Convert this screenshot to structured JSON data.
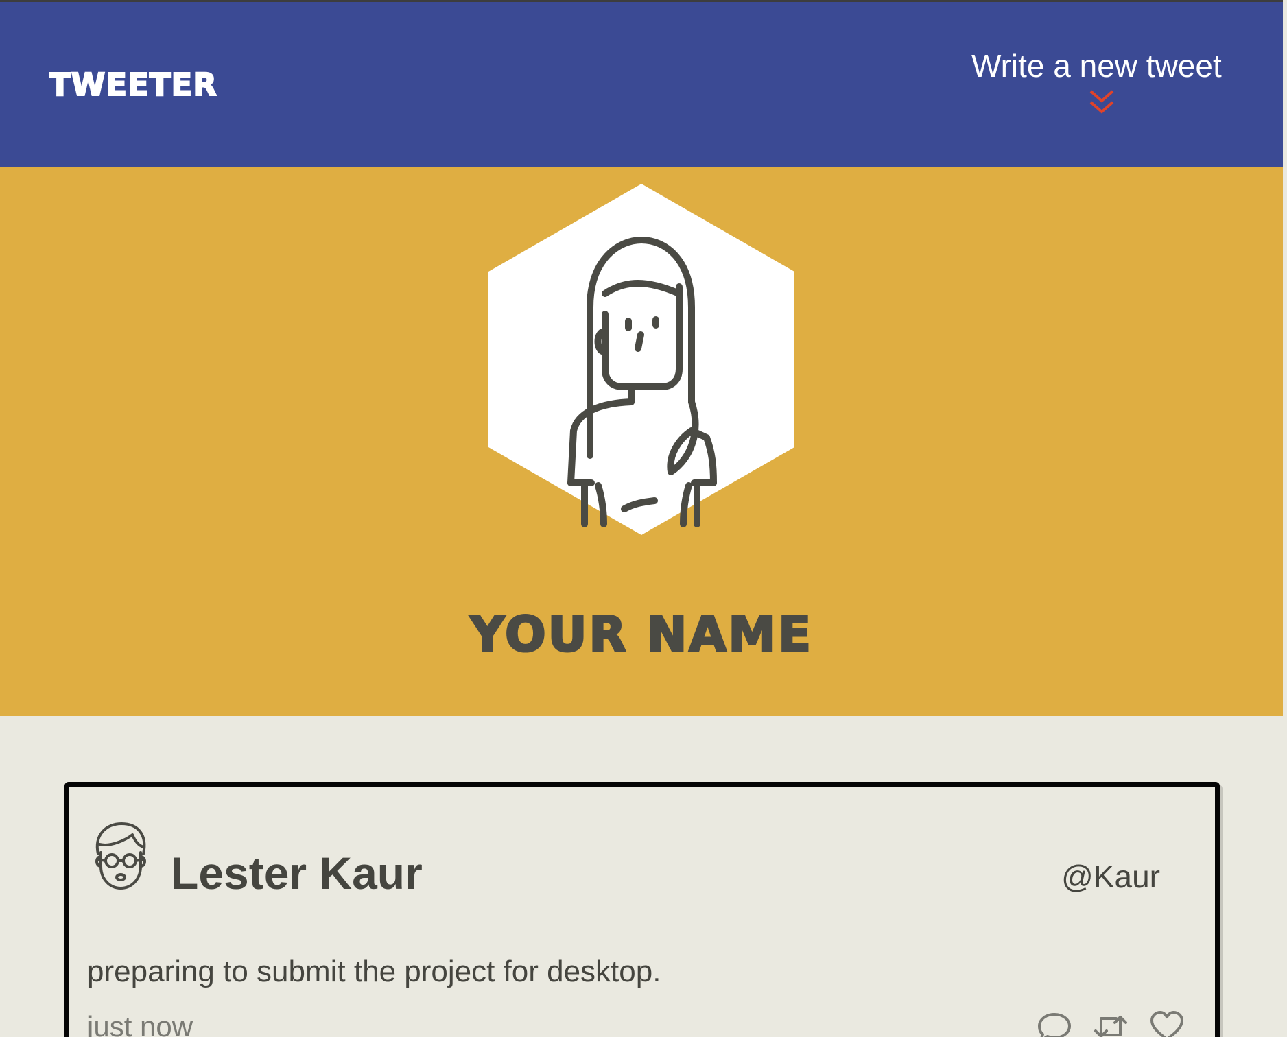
{
  "nav": {
    "brand": "TWEETER",
    "compose_label": "Write a new tweet",
    "compose_icon": "double-chevron-down-icon",
    "accent_color": "#e0432a"
  },
  "profile": {
    "name": "YOUR NAME",
    "avatar_icon": "woman-avatar-icon",
    "background_color": "#dfae42"
  },
  "tweet": {
    "author_name": "Lester Kaur",
    "handle": "@Kaur",
    "avatar_icon": "man-glasses-avatar-icon",
    "content": "preparing to submit the project for desktop.",
    "timestamp": "just now",
    "actions": [
      "comment-icon",
      "retweet-icon",
      "heart-icon"
    ]
  },
  "colors": {
    "nav_bg": "#3b4a94",
    "page_bg": "#eae9e0",
    "text": "#45453f"
  }
}
